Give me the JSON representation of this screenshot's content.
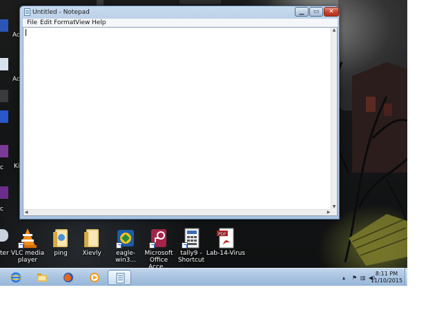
{
  "window": {
    "title": "Untitled - Notepad",
    "buttons": {
      "minimize": "▁",
      "maximize": "▭",
      "close": "✕"
    },
    "menu": [
      "File",
      "Edit",
      "Format",
      "View",
      "Help"
    ],
    "editor_text": ""
  },
  "left_edge_labels": [
    "Ac",
    "Ad",
    "",
    "",
    "Ki",
    "",
    "c",
    "c",
    "ter"
  ],
  "desktop_icons": [
    {
      "label_line1": "VLC media",
      "label_line2": "player",
      "icon": "vlc-cone-icon"
    },
    {
      "label_line1": "ping",
      "label_line2": "",
      "icon": "folder-icon"
    },
    {
      "label_line1": "Xievly",
      "label_line2": "",
      "icon": "folder-icon"
    },
    {
      "label_line1": "eagle-win3...",
      "label_line2": "",
      "icon": "eagle-app-icon"
    },
    {
      "label_line1": "Microsoft",
      "label_line2": "Office Acce...",
      "icon": "access-key-icon"
    },
    {
      "label_line1": "tally9 -",
      "label_line2": "Shortcut",
      "icon": "tally-calculator-icon"
    },
    {
      "label_line1": "Lab-14-Virus",
      "label_line2": "",
      "icon": "pdf-icon"
    }
  ],
  "taskbar": {
    "items": [
      "internet-explorer-icon",
      "file-explorer-icon",
      "firefox-icon",
      "media-player-icon",
      "notepad-icon"
    ],
    "active_item": "notepad-icon",
    "tray": {
      "time": "8:11 PM",
      "date": "11/10/2015"
    }
  },
  "colors": {
    "taskbar": "#a9c3e0",
    "window_frame": "#b7cde6",
    "close_button": "#c2412b"
  }
}
